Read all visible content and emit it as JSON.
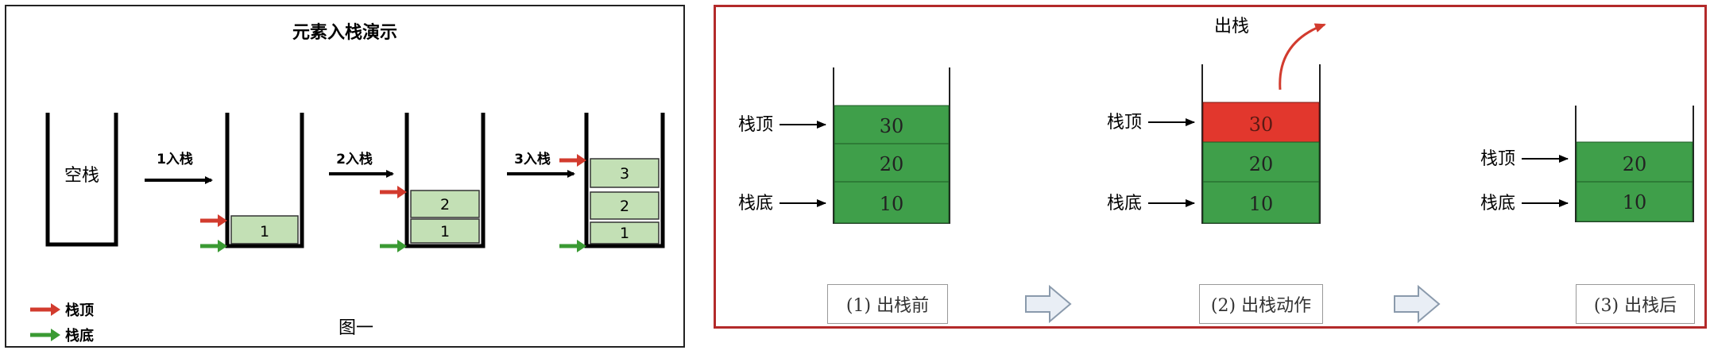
{
  "left": {
    "title": "元素入栈演示",
    "empty_stack_label": "空栈",
    "arrow_labels": [
      "1入栈",
      "2入栈",
      "3入栈"
    ],
    "stacks": [
      [],
      [
        "1"
      ],
      [
        "1",
        "2"
      ],
      [
        "1",
        "2",
        "3"
      ]
    ],
    "legend": {
      "top": "栈顶",
      "bottom": "栈底"
    },
    "figure_caption": "图一",
    "colors": {
      "cell": "#c3e0b5",
      "top_arrow": "#d23b2e",
      "bottom_arrow": "#3a9a33"
    }
  },
  "right": {
    "pop_label": "出栈",
    "labels": {
      "top": "栈顶",
      "bottom": "栈底"
    },
    "stages": [
      {
        "caption": "(1) 出栈前",
        "cells": [
          "30",
          "20",
          "10"
        ]
      },
      {
        "caption": "(2) 出栈动作",
        "cells": [
          "30",
          "20",
          "10"
        ],
        "popping": "30"
      },
      {
        "caption": "(3) 出栈后",
        "cells": [
          "20",
          "10"
        ]
      }
    ],
    "colors": {
      "cell": "#3f9f4a",
      "pop_cell": "#e2372d",
      "border": "#b32a2a"
    }
  }
}
